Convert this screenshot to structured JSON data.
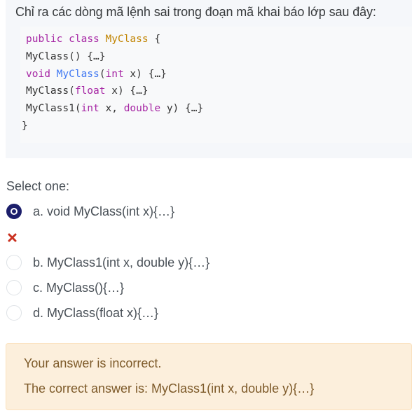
{
  "question": {
    "text": "Chỉ ra các dòng mã lệnh sai trong đoạn mã khai báo lớp sau đây:",
    "code_lines": [
      [
        {
          "t": "public",
          "c": "kw"
        },
        {
          "t": " "
        },
        {
          "t": "class",
          "c": "kw"
        },
        {
          "t": " "
        },
        {
          "t": "MyClass",
          "c": "cls"
        },
        {
          "t": " {"
        }
      ],
      [
        {
          "t": "MyClass() {…}"
        }
      ],
      [
        {
          "t": "void",
          "c": "kw"
        },
        {
          "t": " "
        },
        {
          "t": "MyClass",
          "c": "fn"
        },
        {
          "t": "("
        },
        {
          "t": "int",
          "c": "kw"
        },
        {
          "t": " x) {…}"
        }
      ],
      [
        {
          "t": "MyClass("
        },
        {
          "t": "float",
          "c": "kw"
        },
        {
          "t": " x) {…}"
        }
      ],
      [
        {
          "t": "MyClass1("
        },
        {
          "t": "int",
          "c": "kw"
        },
        {
          "t": " x, "
        },
        {
          "t": "double",
          "c": "kw"
        },
        {
          "t": " y) {…}"
        }
      ],
      [
        {
          "t": "}"
        }
      ]
    ]
  },
  "prompt": "Select one:",
  "options": [
    {
      "label": "a. void MyClass(int x){…}",
      "checked": true,
      "incorrect": true
    },
    {
      "label": "b. MyClass1(int x, double y){…}",
      "checked": false
    },
    {
      "label": "c. MyClass(){…}",
      "checked": false
    },
    {
      "label": "d. MyClass(float x){…}",
      "checked": false
    }
  ],
  "feedback": {
    "status": "Your answer is incorrect.",
    "correct": "The correct answer is: MyClass1(int x, double y){…}"
  },
  "icons": {
    "incorrect": "close-icon"
  },
  "colors": {
    "incorrect": "#ca3120",
    "radio_checked": "#1c1f6b",
    "feedback_bg": "#fcefdc"
  }
}
